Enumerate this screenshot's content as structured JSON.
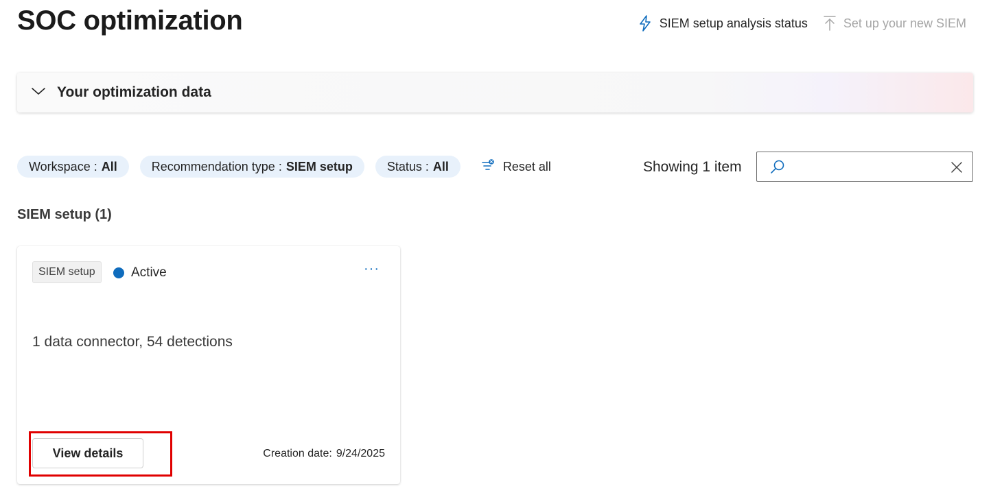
{
  "page": {
    "title": "SOC optimization"
  },
  "top_actions": {
    "siem_status": {
      "label": "SIEM setup analysis status",
      "icon": "lightning-icon",
      "enabled": true
    },
    "new_siem": {
      "label": "Set up your new SIEM",
      "icon": "arrow-up-icon",
      "enabled": false
    }
  },
  "optimization_panel": {
    "title": "Your optimization data",
    "expanded": false
  },
  "filters": [
    {
      "label": "Workspace : ",
      "value": "All"
    },
    {
      "label": "Recommendation type : ",
      "value": "SIEM setup"
    },
    {
      "label": "Status : ",
      "value": "All"
    }
  ],
  "reset_label": "Reset all",
  "showing_label": "Showing 1 item",
  "search": {
    "value": "",
    "placeholder": ""
  },
  "section": {
    "heading": "SIEM setup (1)"
  },
  "card": {
    "tag": "SIEM setup",
    "status": "Active",
    "more_label": "···",
    "description": "1 data connector, 54 detections",
    "button_label": "View details",
    "created_label": "Creation date:",
    "created_date": "9/24/2025"
  },
  "colors": {
    "accent": "#0f6cbd",
    "pill_bg": "#e8f1fb",
    "highlight": "#e00000",
    "disabled": "#a6a6a6"
  }
}
